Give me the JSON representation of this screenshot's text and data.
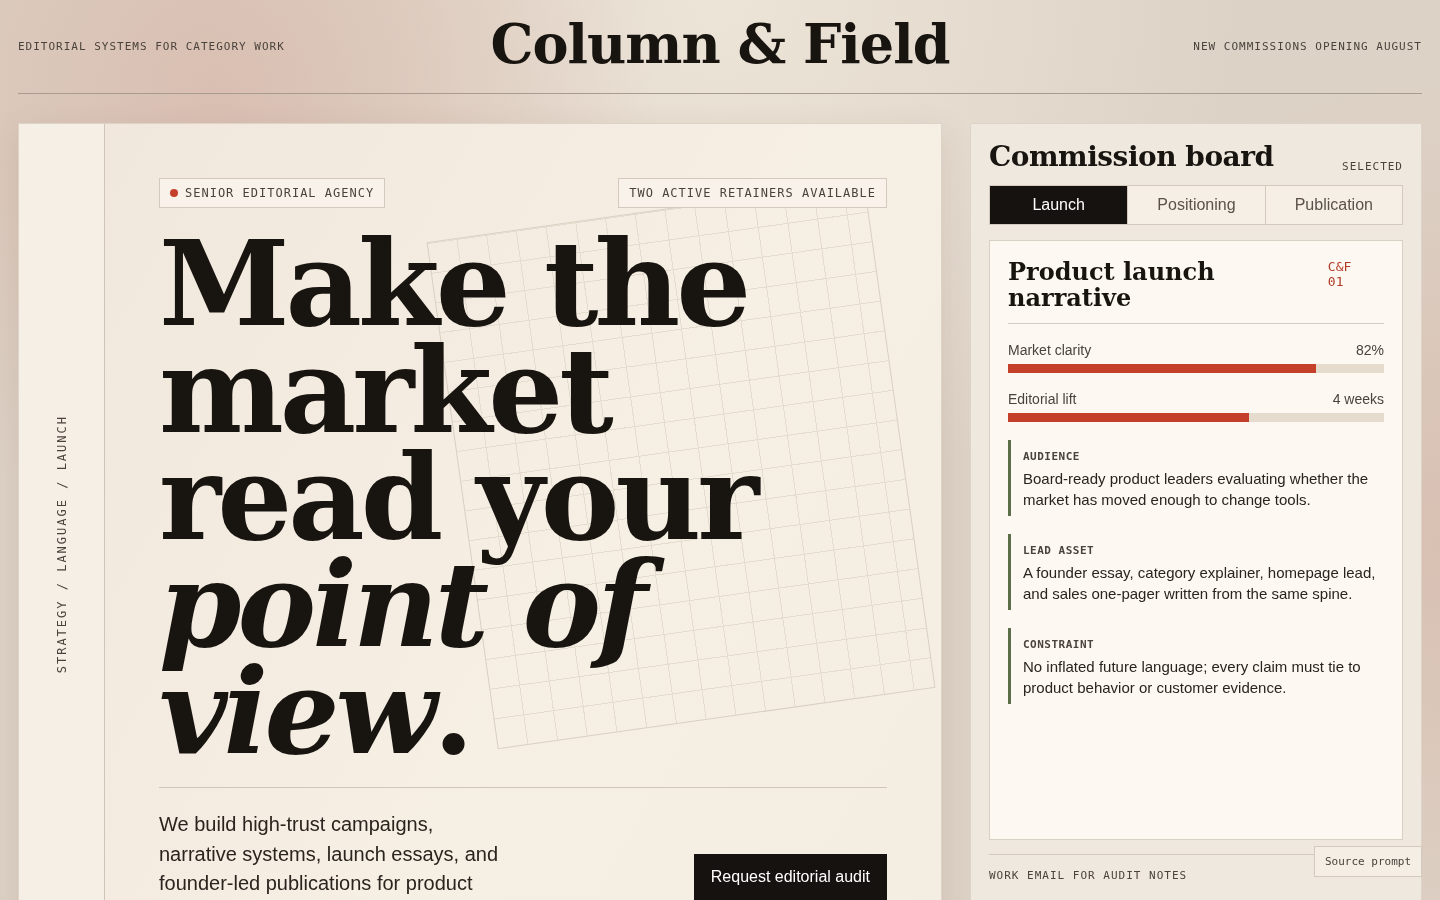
{
  "header": {
    "tagline": "EDITORIAL SYSTEMS FOR CATEGORY WORK",
    "brand": "Column & Field",
    "notice": "NEW COMMISSIONS OPENING AUGUST"
  },
  "hero": {
    "rail": "STRATEGY / LANGUAGE / LAUNCH",
    "badges": [
      {
        "text": "SENIOR EDITORIAL AGENCY",
        "color": "#c4402a"
      },
      {
        "text": "TWO ACTIVE RETAINERS AVAILABLE"
      }
    ],
    "headline": "Make the market read your *point of view*.",
    "intro": "We build high-trust campaigns, narrative systems, launch essays, and founder-led publications for product",
    "cta": "Request editorial audit"
  },
  "board": {
    "title": "Commission board",
    "status": "SELECTED",
    "tabs": [
      {
        "label": "Launch",
        "selected": true
      },
      {
        "label": "Positioning",
        "selected": false
      },
      {
        "label": "Publication",
        "selected": false
      }
    ],
    "card": {
      "title": "Product launch narrative",
      "code": "C&F 01",
      "metrics": [
        {
          "label": "Market clarity",
          "reading": "82%",
          "level": 0.82
        },
        {
          "label": "Editorial lift",
          "reading": "4 weeks",
          "level": 0.64
        }
      ],
      "notes": [
        {
          "label": "AUDIENCE",
          "text": "Board-ready product leaders evaluating whether the market has moved enough to change tools."
        },
        {
          "label": "LEAD ASSET",
          "text": "A founder essay, category explainer, homepage lead, and sales one-pager written from the same spine."
        },
        {
          "label": "CONSTRAINT",
          "text": "No inflated future language; every claim must tie to product behavior or customer evidence."
        }
      ]
    },
    "source_button": "Source prompt",
    "email_label": "WORK EMAIL FOR AUDIT NOTES"
  }
}
